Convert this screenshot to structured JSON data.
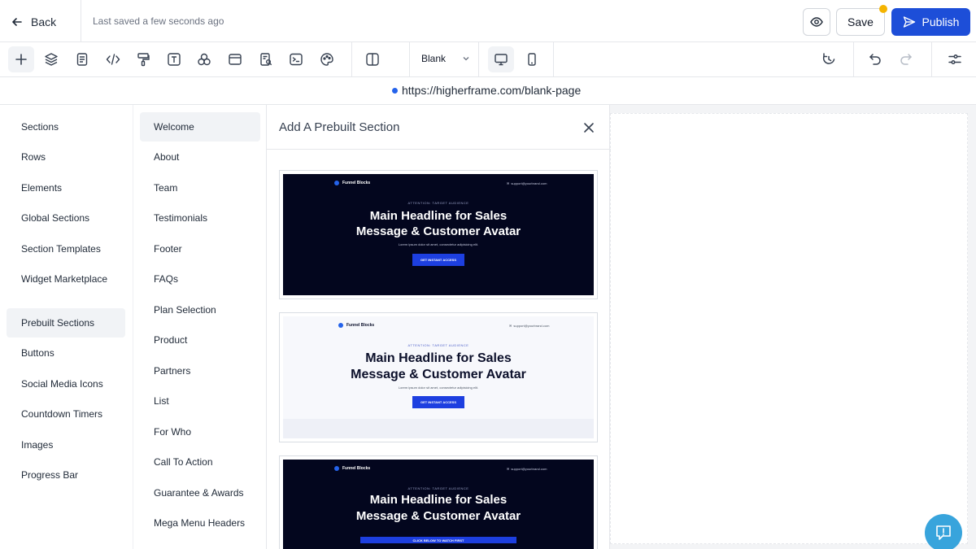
{
  "header": {
    "back_label": "Back",
    "saved_status": "Last saved a few seconds ago",
    "save_label": "Save",
    "publish_label": "Publish"
  },
  "toolbar": {
    "tools": [
      {
        "icon": "plus-icon",
        "active": true
      },
      {
        "icon": "layers-icon"
      },
      {
        "icon": "page-icon"
      },
      {
        "icon": "code-icon"
      },
      {
        "icon": "paint-roller-icon"
      },
      {
        "icon": "text-icon"
      },
      {
        "icon": "shapes-icon"
      },
      {
        "icon": "browser-window-icon"
      },
      {
        "icon": "search-document-icon"
      },
      {
        "icon": "terminal-icon"
      },
      {
        "icon": "palette-icon"
      }
    ],
    "template_select": "Blank",
    "devices": [
      "desktop-icon",
      "mobile-icon"
    ],
    "right_tools": [
      "history-icon",
      "undo-icon",
      "redo-icon",
      "settings-sliders-icon"
    ]
  },
  "url_bar": {
    "url": "https://higherframe.com/blank-page"
  },
  "sidebar": {
    "items": [
      {
        "label": "Sections"
      },
      {
        "label": "Rows"
      },
      {
        "label": "Elements"
      },
      {
        "label": "Global Sections"
      },
      {
        "label": "Section Templates"
      },
      {
        "label": "Widget Marketplace"
      },
      {
        "label": "Prebuilt Sections",
        "active": true
      },
      {
        "label": "Buttons"
      },
      {
        "label": "Social Media Icons"
      },
      {
        "label": "Countdown Timers"
      },
      {
        "label": "Images"
      },
      {
        "label": "Progress Bar"
      }
    ]
  },
  "categories": {
    "items": [
      {
        "label": "Welcome",
        "active": true
      },
      {
        "label": "About"
      },
      {
        "label": "Team"
      },
      {
        "label": "Testimonials"
      },
      {
        "label": "Footer"
      },
      {
        "label": "FAQs"
      },
      {
        "label": "Plan Selection"
      },
      {
        "label": "Product"
      },
      {
        "label": "Partners"
      },
      {
        "label": "List"
      },
      {
        "label": "For Who"
      },
      {
        "label": "Call To Action"
      },
      {
        "label": "Guarantee & Awards"
      },
      {
        "label": "Mega Menu Headers"
      }
    ]
  },
  "prebuilt": {
    "title": "Add A Prebuilt Section",
    "cards": [
      {
        "theme": "dark",
        "logo": "Funnel Blocks",
        "email": "support@yourbrand.com",
        "attention": "ATTENTION: TARGET AUDIENCE",
        "headline_1": "Main Headline for Sales",
        "headline_2": "Message & Customer Avatar",
        "subtext": "Lorem ipsum dolor sit amet, consectetur adipisicing elit.",
        "cta": "GET INSTANT ACCESS"
      },
      {
        "theme": "light",
        "logo": "Funnel Blocks",
        "email": "support@yourbrand.com",
        "attention": "ATTENTION: TARGET AUDIENCE",
        "headline_1": "Main Headline for Sales",
        "headline_2": "Message & Customer Avatar",
        "subtext": "Lorem ipsum dolor sit amet, consectetur adipisicing elit.",
        "cta": "GET INSTANT ACCESS"
      },
      {
        "theme": "dark",
        "logo": "Funnel Blocks",
        "email": "support@yourbrand.com",
        "attention": "ATTENTION: TARGET AUDIENCE",
        "headline_1": "Main Headline for Sales",
        "headline_2": "Message & Customer Avatar",
        "cta": "CLICK BELOW TO WATCH FIRST"
      }
    ]
  },
  "colors": {
    "accent": "#1d4ed8",
    "notification_dot": "#f5b400",
    "chat_widget": "#38a4dc",
    "card_dark_bg": "#03061e"
  }
}
